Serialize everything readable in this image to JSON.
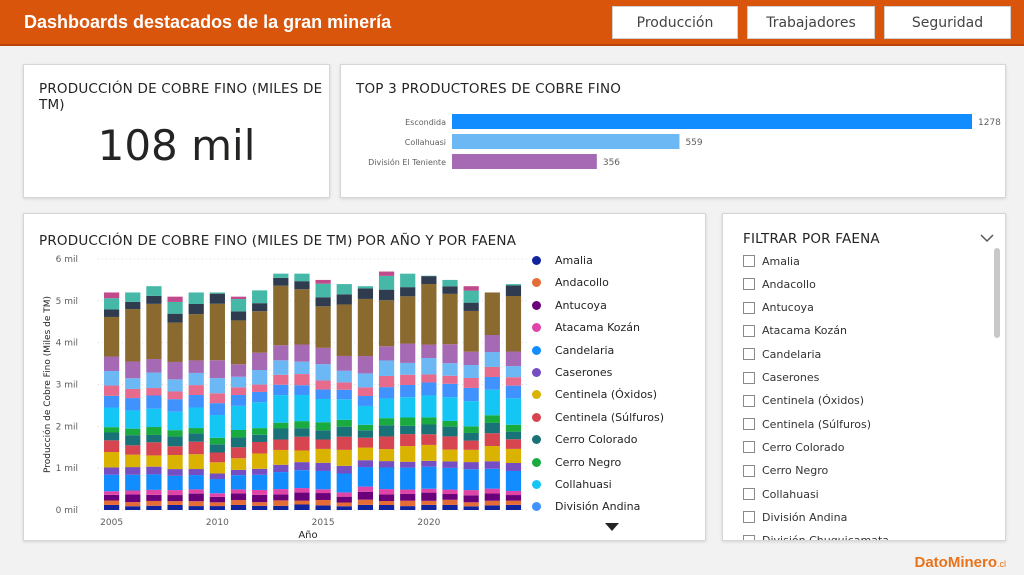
{
  "header": {
    "title": "Dashboards destacados de la gran minería",
    "nav": [
      "Producción",
      "Trabajadores",
      "Seguridad"
    ]
  },
  "kpi": {
    "title": "PRODUCCIÓN DE COBRE FINO (MILES DE TM)",
    "value": "108 mil"
  },
  "top3": {
    "title": "TOP 3 PRODUCTORES DE COBRE FINO",
    "bars": [
      {
        "name": "Escondida",
        "value": 1278,
        "color": "#118dff"
      },
      {
        "name": "Collahuasi",
        "value": 559,
        "color": "#6cb8f5"
      },
      {
        "name": "División El Teniente",
        "value": 356,
        "color": "#a66ab5"
      }
    ]
  },
  "stacked": {
    "title": "PRODUCCIÓN DE COBRE FINO (MILES DE TM) POR AÑO Y POR FAENA",
    "ylabel": "Producción de Cobre Fino (Miles de TM)",
    "xlabel": "Año",
    "yticks": [
      "0 mil",
      "1 mil",
      "2 mil",
      "3 mil",
      "4 mil",
      "5 mil",
      "6 mil"
    ],
    "xticks": [
      "2005",
      "2010",
      "2015",
      "2020"
    ]
  },
  "legend": [
    {
      "name": "Amalia",
      "color": "#12239e"
    },
    {
      "name": "Andacollo",
      "color": "#e66c37"
    },
    {
      "name": "Antucoya",
      "color": "#6b007b"
    },
    {
      "name": "Atacama Kozán",
      "color": "#e044a7"
    },
    {
      "name": "Candelaria",
      "color": "#118dff"
    },
    {
      "name": "Caserones",
      "color": "#744ec2"
    },
    {
      "name": "Centinela (Óxidos)",
      "color": "#d9b300"
    },
    {
      "name": "Centinela (Súlfuros)",
      "color": "#d64550"
    },
    {
      "name": "Cerro Colorado",
      "color": "#197278"
    },
    {
      "name": "Cerro Negro",
      "color": "#1aab40"
    },
    {
      "name": "Collahuasi",
      "color": "#15c6f4"
    },
    {
      "name": "División Andina",
      "color": "#4092ff"
    }
  ],
  "filter": {
    "title": "FILTRAR POR FAENA",
    "items": [
      "Amalia",
      "Andacollo",
      "Antucoya",
      "Atacama Kozán",
      "Candelaria",
      "Caserones",
      "Centinela (Óxidos)",
      "Centinela (Súlfuros)",
      "Cerro Colorado",
      "Cerro Negro",
      "Collahuasi",
      "División Andina",
      "División Chuquicamata"
    ]
  },
  "footer": {
    "brand": "DatoMinero",
    "tld": ".cl"
  },
  "chart_data": [
    {
      "type": "bar",
      "title": "TOP 3 PRODUCTORES DE COBRE FINO",
      "categories": [
        "Escondida",
        "Collahuasi",
        "División El Teniente"
      ],
      "values": [
        1278,
        559,
        356
      ]
    },
    {
      "type": "bar",
      "stacked": true,
      "title": "PRODUCCIÓN DE COBRE FINO (MILES DE TM) POR AÑO Y POR FAENA",
      "xlabel": "Año",
      "ylabel": "Producción de Cobre Fino (Miles de TM)",
      "ylim": [
        0,
        6000
      ],
      "x": [
        2005,
        2006,
        2007,
        2008,
        2009,
        2010,
        2011,
        2012,
        2013,
        2014,
        2015,
        2016,
        2017,
        2018,
        2019,
        2020,
        2021,
        2022,
        2023,
        2024
      ],
      "totals": [
        5200,
        5200,
        5350,
        5100,
        5200,
        5200,
        5100,
        5250,
        5650,
        5650,
        5500,
        5400,
        5350,
        5700,
        5650,
        5600,
        5500,
        5350,
        5200,
        5400
      ],
      "grid": true,
      "legend_position": "right"
    }
  ]
}
